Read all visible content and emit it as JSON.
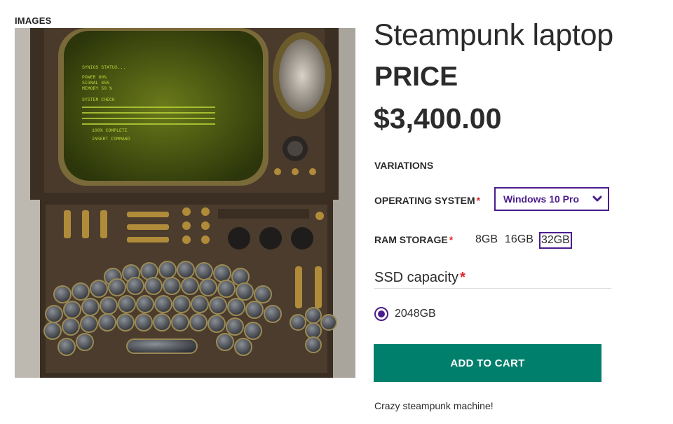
{
  "images_label": "IMAGES",
  "product": {
    "title": "Steampunk laptop",
    "price_label": "PRICE",
    "price": "$3,400.00",
    "description": "Crazy steampunk machine!"
  },
  "variations": {
    "heading": "VARIATIONS",
    "operating_system": {
      "label": "OPERATING SYSTEM",
      "required_mark": "*",
      "selected": "Windows 10 Pro"
    },
    "ram_storage": {
      "label": "RAM STORAGE",
      "required_mark": "*",
      "options": [
        "8GB",
        "16GB",
        "32GB"
      ],
      "selected": "32GB"
    },
    "ssd_capacity": {
      "label": "SSD capacity",
      "required_mark": "*",
      "options": [
        "2048GB"
      ],
      "selected": "2048GB"
    }
  },
  "add_to_cart_label": "ADD TO CART",
  "screen_text": [
    "SYNIOS STATUS...",
    "POWER 80%",
    "SIGNAL 85%",
    "MEMORY 50 %",
    "SYSTEM CHECK",
    "100% COMPLETE",
    "INSERT COMMAND"
  ],
  "colors": {
    "accent": "#4b1d8b",
    "cart_button": "#007f6c",
    "required": "#e0262b",
    "text": "#2b2b2b"
  }
}
